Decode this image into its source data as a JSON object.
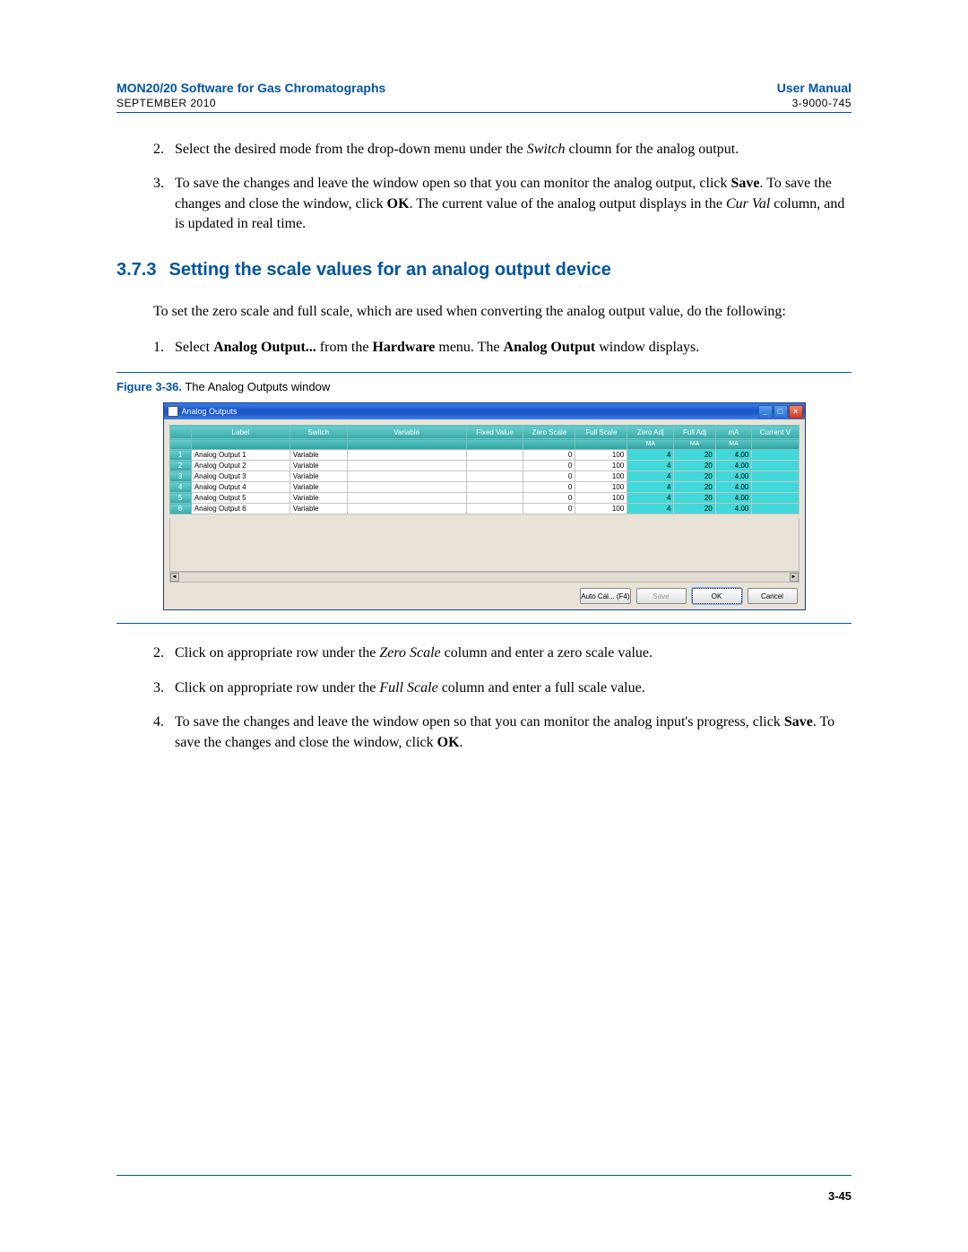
{
  "header": {
    "title_left": "MON20/20 Software for Gas Chromatographs",
    "title_right": "User Manual",
    "sub_left": "SEPTEMBER 2010",
    "sub_right": "3-9000-745"
  },
  "body_pre": {
    "item2_num": "2.",
    "item2_a": "Select the desired mode from the drop-down menu under the ",
    "item2_i": "Switch",
    "item2_b": " cloumn for the analog output.",
    "item3_num": "3.",
    "item3_a": "To save the changes and leave the window open so that you can monitor the analog output, click ",
    "item3_bold1": "Save",
    "item3_b": ".  To save the changes and close the window, click ",
    "item3_bold2": "OK",
    "item3_c": ".  The current value of the analog output displays in the ",
    "item3_i": "Cur Val",
    "item3_d": " column, and is updated in real time."
  },
  "section": {
    "num": "3.7.3",
    "title": "Setting the scale values for an analog output device",
    "intro": "To set the zero scale and full scale, which are used when converting the analog output value, do the following:",
    "step1_num": "1.",
    "step1_a": "Select ",
    "step1_bold1": "Analog Output...",
    "step1_b": " from the ",
    "step1_bold2": "Hardware",
    "step1_c": " menu.  The ",
    "step1_bold3": "Analog Output",
    "step1_d": " window displays."
  },
  "figure": {
    "num": "Figure 3-36.",
    "caption": "  The Analog Outputs window"
  },
  "window": {
    "title": "Analog Outputs",
    "headers": {
      "label": "Label",
      "switch": "Switch",
      "variable": "Variable",
      "fixed": "Fixed Value",
      "zero": "Zero Scale",
      "full": "Full Scale",
      "zeroadj": "Zero Adj",
      "fulladj": "Full Adj",
      "ma": "mA",
      "current": "Current V"
    },
    "subheaders": {
      "ma1": "MA",
      "ma2": "MA",
      "ma3": "MA"
    },
    "rows": [
      {
        "n": "1",
        "label": "Analog Output 1",
        "switch": "Variable",
        "variable": "",
        "fixed": "",
        "zero": "0",
        "full": "100",
        "zeroadj": "4",
        "fulladj": "20",
        "ma": "4.00",
        "cur": ""
      },
      {
        "n": "2",
        "label": "Analog Output 2",
        "switch": "Variable",
        "variable": "",
        "fixed": "",
        "zero": "0",
        "full": "100",
        "zeroadj": "4",
        "fulladj": "20",
        "ma": "4.00",
        "cur": ""
      },
      {
        "n": "3",
        "label": "Analog Output 3",
        "switch": "Variable",
        "variable": "",
        "fixed": "",
        "zero": "0",
        "full": "100",
        "zeroadj": "4",
        "fulladj": "20",
        "ma": "4.00",
        "cur": ""
      },
      {
        "n": "4",
        "label": "Analog Output 4",
        "switch": "Variable",
        "variable": "",
        "fixed": "",
        "zero": "0",
        "full": "100",
        "zeroadj": "4",
        "fulladj": "20",
        "ma": "4.00",
        "cur": ""
      },
      {
        "n": "5",
        "label": "Analog Output 5",
        "switch": "Variable",
        "variable": "",
        "fixed": "",
        "zero": "0",
        "full": "100",
        "zeroadj": "4",
        "fulladj": "20",
        "ma": "4.00",
        "cur": ""
      },
      {
        "n": "6",
        "label": "Analog Output 6",
        "switch": "Variable",
        "variable": "",
        "fixed": "",
        "zero": "0",
        "full": "100",
        "zeroadj": "4",
        "fulladj": "20",
        "ma": "4.00",
        "cur": ""
      }
    ],
    "buttons": {
      "autocal": "Auto Cal... (F4)",
      "save": "Save",
      "ok": "OK",
      "cancel": "Cancel"
    }
  },
  "body_post": {
    "item2_num": "2.",
    "item2_a": "Click on appropriate row under the ",
    "item2_i": "Zero Scale",
    "item2_b": " column and enter a zero scale value.",
    "item3_num": "3.",
    "item3_a": "Click on appropriate row under the ",
    "item3_i": "Full Scale",
    "item3_b": " column and enter a full scale value.",
    "item4_num": "4.",
    "item4_a": "To save the changes and leave the window open so that you can monitor the analog input's progress, click ",
    "item4_bold1": "Save",
    "item4_b": ".  To save the changes and close the window, click ",
    "item4_bold2": "OK",
    "item4_c": "."
  },
  "page_number": "3-45"
}
